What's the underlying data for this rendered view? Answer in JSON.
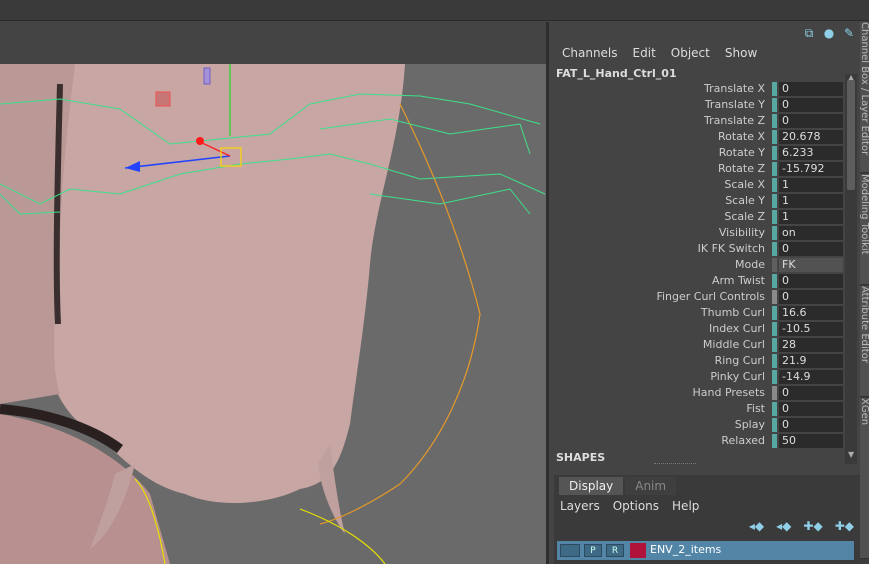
{
  "colors": {
    "accent": "#57a7a3",
    "layer_selected": "#5285a6",
    "layer_color": "#b0123a"
  },
  "panel": {
    "top_icons": [
      "node-editor-icon",
      "help-icon",
      "pin-icon"
    ],
    "menu": [
      "Channels",
      "Edit",
      "Object",
      "Show"
    ],
    "node_name": "FAT_L_Hand_Ctrl_01",
    "attributes": [
      {
        "label": "Translate X",
        "value": "0"
      },
      {
        "label": "Translate Y",
        "value": "0"
      },
      {
        "label": "Translate Z",
        "value": "0"
      },
      {
        "label": "Rotate X",
        "value": "20.678"
      },
      {
        "label": "Rotate Y",
        "value": "6.233"
      },
      {
        "label": "Rotate Z",
        "value": "-15.792"
      },
      {
        "label": "Scale X",
        "value": "1"
      },
      {
        "label": "Scale Y",
        "value": "1"
      },
      {
        "label": "Scale Z",
        "value": "1"
      },
      {
        "label": "Visibility",
        "value": "on"
      },
      {
        "label": "IK FK Switch",
        "value": "0"
      },
      {
        "label": "Mode",
        "value": "FK"
      },
      {
        "label": "Arm Twist",
        "value": "0"
      },
      {
        "label": "Finger Curl Controls",
        "value": "0"
      },
      {
        "label": "Thumb Curl",
        "value": "16.6"
      },
      {
        "label": "Index Curl",
        "value": "-10.5"
      },
      {
        "label": "Middle Curl",
        "value": "28"
      },
      {
        "label": "Ring Curl",
        "value": "21.9"
      },
      {
        "label": "Pinky Curl",
        "value": "-14.9"
      },
      {
        "label": "Hand Presets",
        "value": "0"
      },
      {
        "label": "Fist",
        "value": "0"
      },
      {
        "label": "Splay",
        "value": "0"
      },
      {
        "label": "Relaxed",
        "value": "50"
      }
    ],
    "shapes_label": "SHAPES"
  },
  "layer_editor": {
    "tabs": [
      "Display",
      "Anim"
    ],
    "menu": [
      "Layers",
      "Options",
      "Help"
    ],
    "icons": [
      "move-layer-up-icon",
      "move-layer-down-icon",
      "new-layer-icon",
      "new-layer-selected-icon"
    ],
    "layer": {
      "v": "",
      "p": "P",
      "r": "R",
      "name": "ENV_2_items"
    }
  },
  "side_tabs": [
    "Channel Box / Layer Editor",
    "Modeling Toolkit",
    "Attribute Editor",
    "XGen"
  ]
}
